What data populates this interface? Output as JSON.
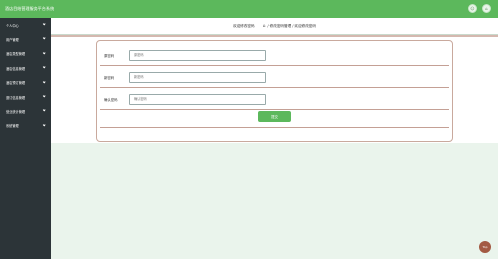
{
  "app": {
    "title": "酒店目结营理服务平台系统"
  },
  "topbar": {
    "icon1": "☺",
    "icon2": "⌂"
  },
  "sidebar": {
    "items": [
      {
        "label": "个人中心"
      },
      {
        "label": "用户管理"
      },
      {
        "label": "酒店类型管理"
      },
      {
        "label": "酒店信息管理"
      },
      {
        "label": "酒店预订管理"
      },
      {
        "label": "退订信息管理"
      },
      {
        "label": "营业统计管理"
      },
      {
        "label": "系统管理"
      }
    ]
  },
  "breadcrumb": {
    "title": "欢迎修改密码",
    "home_icon": "⌂",
    "sep": "/",
    "item1": "修改密码管理",
    "item2": "欢迎修改密码"
  },
  "form": {
    "fields": [
      {
        "label": "原密码",
        "placeholder": "原密码"
      },
      {
        "label": "新密码",
        "placeholder": "新密码"
      },
      {
        "label": "确认密码",
        "placeholder": "确认密码"
      }
    ],
    "submit_label": "提交"
  },
  "scroll_top": {
    "label": "Top"
  },
  "colors": {
    "primary": "#5cb85c",
    "sidebar": "#2c3438",
    "accent_line": "#c4a095",
    "top_button": "#a35a43"
  }
}
